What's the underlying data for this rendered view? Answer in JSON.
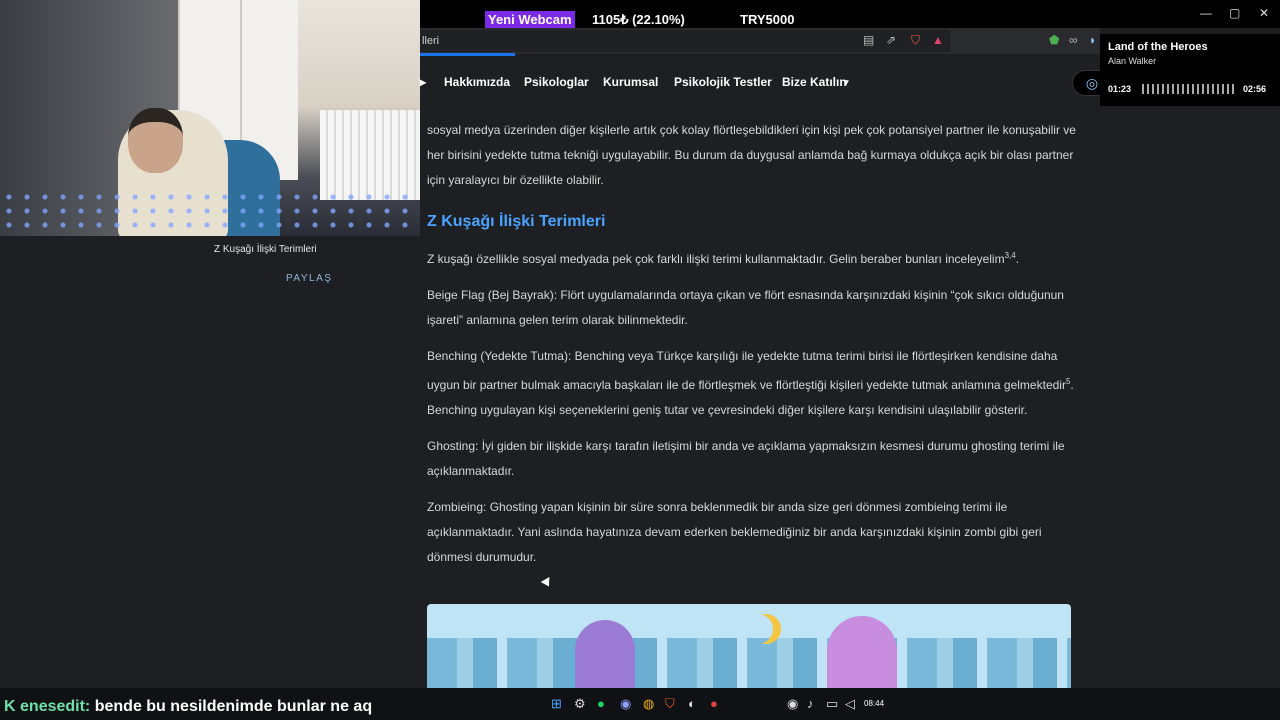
{
  "overlay": {
    "webcam_badge": "Yeni Webcam",
    "stat_1": "1105₺ (22.10%)",
    "stat_2": "TRY5000",
    "min": "—",
    "max": "▢",
    "close": "✕"
  },
  "browser": {
    "address_text": "lleri"
  },
  "nav": {
    "arrow": "▸",
    "items": [
      "Hakkımızda",
      "Psikologlar",
      "Kurumsal",
      "Psikolojik Testler",
      "Bize Katılın"
    ],
    "caret": "▾"
  },
  "left": {
    "caption": "Z Kuşağı İlişki Terimleri",
    "share": "PAYLAŞ"
  },
  "article": {
    "p0_cut": "sosyal medya üzerinden diğer kişilerle artık çok kolay flörtleşebildikleri için kişi pek çok potansiyel partner ile konuşabilir ve her birisini yedekte tutma tekniği uygulayabilir. Bu durum da duygusal anlamda bağ kurmaya oldukça açık bir olası partner için yaralayıcı bir özellikte olabilir.",
    "heading": "Z Kuşağı İlişki Terimleri",
    "intro": "Z kuşağı özellikle sosyal medyada pek çok farklı ilişki terimi kullanmaktadır. Gelin beraber bunları inceleyelim",
    "intro_sup": "3,4",
    "intro_end": ".",
    "beige": "Beige Flag (Bej Bayrak): Flört uygulamalarında ortaya çıkan ve flört esnasında karşınızdaki kişinin “çok sıkıcı olduğunun işareti” anlamına gelen terim olarak bilinmektedir.",
    "benching_a": "Benching (Yedekte Tutma): Benching veya Türkçe karşılığı ile yedekte tutma terimi birisi ile flörtleşirken kendisine daha uygun bir partner bulmak amacıyla başkaları ile de flörtleşmek ve flörtleştiği kişileri yedekte tutmak anlamına gelmektedir",
    "benching_sup": "5",
    "benching_b": ". Benching uygulayan kişi seçeneklerini geniş tutar ve çevresindeki diğer kişilere karşı kendisini ulaşılabilir gösterir.",
    "ghosting": "Ghosting: İyi giden bir ilişkide karşı tarafın iletişimi bir anda ve açıklama yapmaksızın kesmesi durumu ghosting terimi ile açıklanmaktadır.",
    "zombieing": "Zombieing: Ghosting yapan kişinin bir süre sonra beklenmedik bir anda size geri dönmesi zombieing terimi ile açıklanmaktadır. Yani aslında hayatınıza devam ederken beklemediğiniz bir anda karşınızdaki kişinin zombi gibi geri dönmesi durumudur."
  },
  "music": {
    "title": "Land of the Heroes",
    "artist": "Alan Walker",
    "elapsed": "01:23",
    "total": "02:56",
    "progress": 0.47
  },
  "chat": {
    "prefix": "K",
    "user": "enesedit:",
    "message": "bende bu nesildenimde bunlar ne aq"
  },
  "taskbar": {
    "time": "08:44"
  }
}
